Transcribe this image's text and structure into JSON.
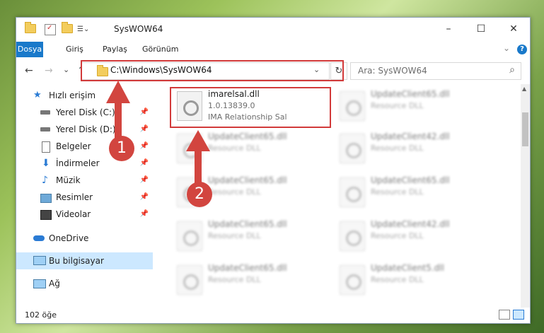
{
  "window": {
    "title": "SysWOW64",
    "minimize": "–",
    "maximize": "☐",
    "close": "✕"
  },
  "ribbon": {
    "tabs": [
      "Dosya",
      "Giriş",
      "Paylaş",
      "Görünüm"
    ],
    "collapse": "⌄",
    "help": "?"
  },
  "nav": {
    "back": "←",
    "forward": "→",
    "recent": "⌄",
    "up": "↑"
  },
  "address": {
    "path": "C:\\Windows\\SysWOW64",
    "dropdown": "⌄",
    "refresh": "↻"
  },
  "search": {
    "placeholder": "Ara: SysWOW64",
    "icon": "⌕"
  },
  "sidebar": {
    "items": [
      {
        "label": "Hızlı erişim",
        "icon": "star-icon",
        "pinned": false
      },
      {
        "label": "Yerel Disk (C:)",
        "icon": "drive-icon",
        "pinned": true
      },
      {
        "label": "Yerel Disk (D:)",
        "icon": "drive-icon",
        "pinned": true
      },
      {
        "label": "Belgeler",
        "icon": "documents-icon",
        "pinned": true
      },
      {
        "label": "İndirmeler",
        "icon": "download-icon",
        "pinned": true
      },
      {
        "label": "Müzik",
        "icon": "music-icon",
        "pinned": true
      },
      {
        "label": "Resimler",
        "icon": "pictures-icon",
        "pinned": true
      },
      {
        "label": "Videolar",
        "icon": "videos-icon",
        "pinned": true
      },
      {
        "label": "OneDrive",
        "icon": "cloud-icon",
        "pinned": false
      },
      {
        "label": "Bu bilgisayar",
        "icon": "computer-icon",
        "pinned": false
      },
      {
        "label": "Ağ",
        "icon": "network-icon",
        "pinned": false
      }
    ],
    "pin_glyph": "📌"
  },
  "files": {
    "main": {
      "name": "imarelsal.dll",
      "version": "1.0.13839.0",
      "desc": "IMA Relationship Sal"
    },
    "blurred": [
      {
        "name": "UpdateClient65.dll",
        "desc": "Resource DLL"
      },
      {
        "name": "UpdateClient65.dll",
        "desc": "Resource DLL"
      },
      {
        "name": "UpdateClient42.dll",
        "desc": "Resource DLL"
      },
      {
        "name": "UpdateClient65.dll",
        "desc": "Resource DLL"
      },
      {
        "name": "UpdateClient65.dll",
        "desc": "Resource DLL"
      },
      {
        "name": "UpdateClient65.dll",
        "desc": "Resource DLL"
      },
      {
        "name": "UpdateClient42.dll",
        "desc": "Resource DLL"
      },
      {
        "name": "UpdateClient65.dll",
        "desc": "Resource DLL"
      },
      {
        "name": "UpdateClient5.dll",
        "desc": "Resource DLL"
      }
    ]
  },
  "status": {
    "count": "102 öğe"
  },
  "annotations": {
    "badge1": "1",
    "badge2": "2"
  },
  "colors": {
    "accent": "#1979ca",
    "highlight": "#d23a3a",
    "badge": "#d2453f",
    "selected": "#cce8ff"
  }
}
